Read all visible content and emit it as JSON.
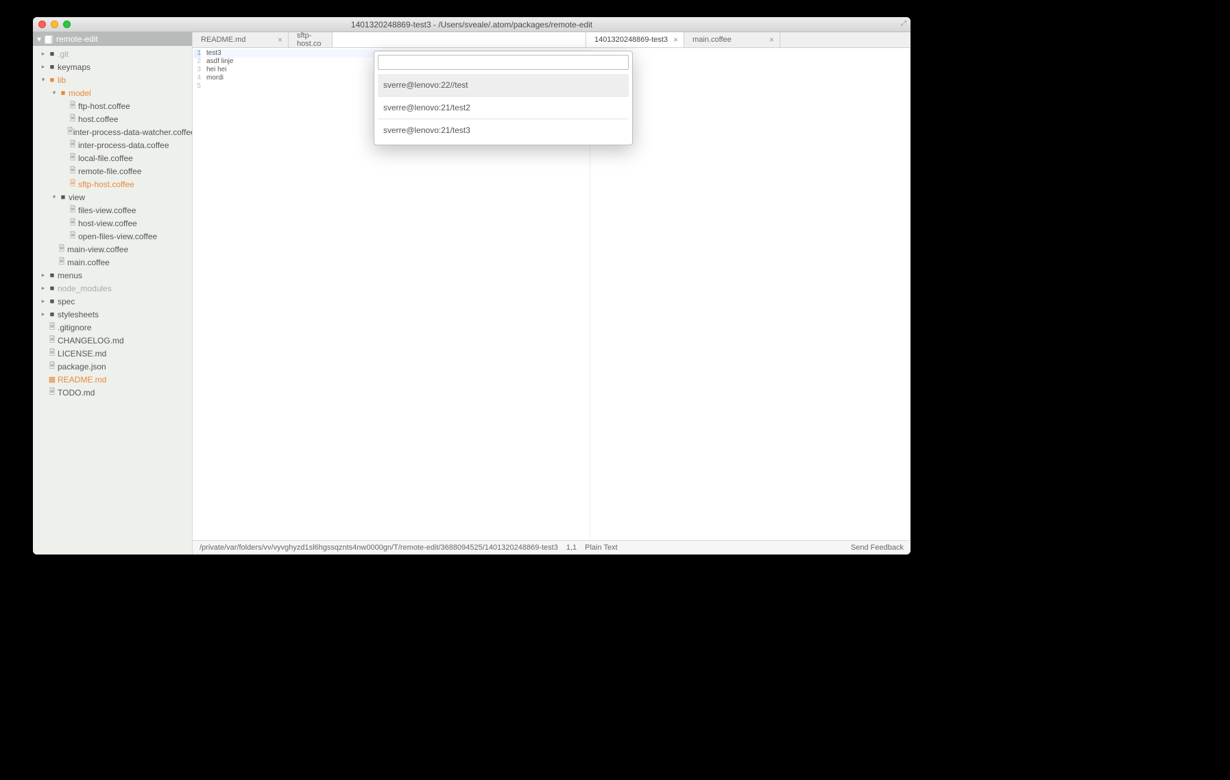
{
  "window": {
    "title": "1401320248869-test3 - /Users/sveale/.atom/packages/remote-edit"
  },
  "project": {
    "root": "remote-edit"
  },
  "tree": {
    "git": ".git",
    "keymaps": "keymaps",
    "lib": "lib",
    "model": "model",
    "ftp_host": "ftp-host.coffee",
    "host": "host.coffee",
    "ipdw": "inter-process-data-watcher.coffee",
    "ipd": "inter-process-data.coffee",
    "local_file": "local-file.coffee",
    "remote_file": "remote-file.coffee",
    "sftp_host": "sftp-host.coffee",
    "view": "view",
    "files_view": "files-view.coffee",
    "host_view": "host-view.coffee",
    "open_files_view": "open-files-view.coffee",
    "main_view": "main-view.coffee",
    "main": "main.coffee",
    "menus": "menus",
    "node_modules": "node_modules",
    "spec": "spec",
    "stylesheets": "stylesheets",
    "gitignore": ".gitignore",
    "changelog": "CHANGELOG.md",
    "license": "LICENSE.md",
    "package_json": "package.json",
    "readme": "README.md",
    "todo": "TODO.md"
  },
  "tabs": [
    {
      "label": "README.md"
    },
    {
      "label": "sftp-host.co"
    },
    {
      "label": ""
    },
    {
      "label": ""
    },
    {
      "label": "1401320248869-test3"
    },
    {
      "label": "main.coffee"
    }
  ],
  "editor": {
    "lines": [
      "test3",
      "asdf linje",
      "hei hei",
      "mordi",
      ""
    ],
    "line_numbers": [
      "1",
      "2",
      "3",
      "4",
      "5"
    ]
  },
  "palette": {
    "input_value": "",
    "items": [
      "sverre@lenovo:22//test",
      "sverre@lenovo:21/test2",
      "sverre@lenovo:21/test3"
    ]
  },
  "statusbar": {
    "path": "/private/var/folders/vv/vyvghyzd1sl6hgssqznts4nw0000gn/T/remote-edit/3688094525/1401320248869-test3",
    "cursor": "1,1",
    "grammar": "Plain Text",
    "feedback": "Send Feedback"
  }
}
